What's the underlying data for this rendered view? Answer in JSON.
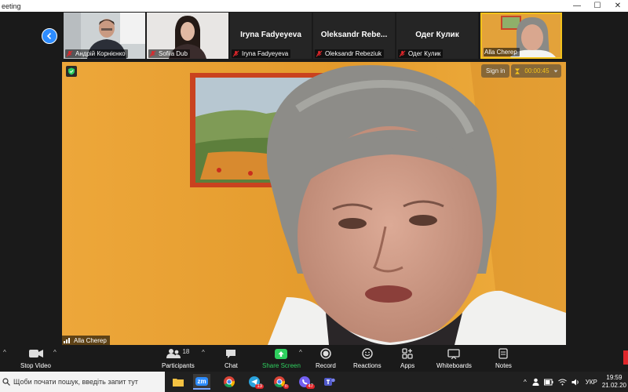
{
  "window": {
    "title": "eeting",
    "controls": [
      "—",
      "☐",
      "✕"
    ]
  },
  "gallery": {
    "tiles": [
      {
        "name": "",
        "label": "Андрій Корнієнко",
        "muted": true,
        "has_video": true
      },
      {
        "name": "",
        "label": "Sofiia Dub",
        "muted": true,
        "has_video": true
      },
      {
        "name": "Iryna Fadyeyeva",
        "label": "Iryna Fadyeyeva",
        "muted": true,
        "has_video": false
      },
      {
        "name": "Oleksandr Rebe...",
        "label": "Oleksandr Rebeziuk",
        "muted": true,
        "has_video": false
      },
      {
        "name": "Одег Кулик",
        "label": "Одег Кулик",
        "muted": true,
        "has_video": false
      },
      {
        "name": "",
        "label": "Alla Cherep",
        "muted": false,
        "has_video": true,
        "active": true
      }
    ]
  },
  "video": {
    "speaker_label": "Alla Cherep",
    "signin_label": "Sign in",
    "timer": "00:00:45"
  },
  "toolbar": {
    "stop_video": "Stop Video",
    "participants": "Participants",
    "participants_count": "18",
    "chat": "Chat",
    "share_screen": "Share Screen",
    "record": "Record",
    "reactions": "Reactions",
    "apps": "Apps",
    "whiteboards": "Whiteboards",
    "notes": "Notes"
  },
  "taskbar": {
    "search_placeholder": "Щоби почати пошук, введіть запит тут",
    "zoom_label": "zm",
    "telegram_badge": "13",
    "chrome2_badge": "n",
    "viber_badge": "47",
    "lang": "УКР",
    "time": "19:59",
    "date": "21.02.20"
  },
  "colors": {
    "accent": "#2d8cff",
    "share_green": "#2fd05f",
    "active_tile": "#f3c21a"
  }
}
